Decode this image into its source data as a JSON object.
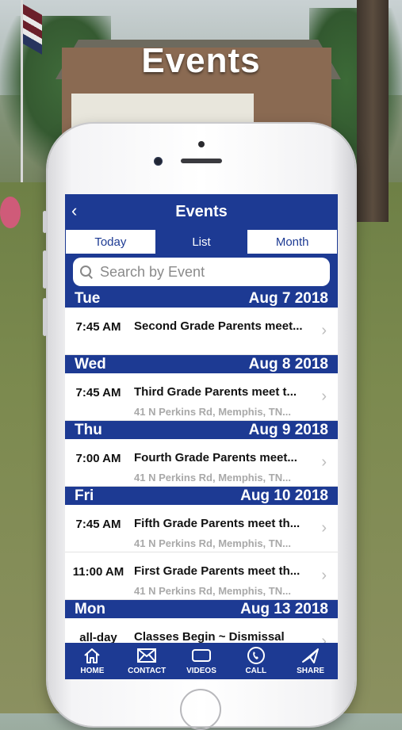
{
  "page": {
    "title": "Events"
  },
  "navbar": {
    "back_glyph": "‹",
    "title": "Events"
  },
  "segments": [
    {
      "label": "Today",
      "active": false
    },
    {
      "label": "List",
      "active": true
    },
    {
      "label": "Month",
      "active": false
    }
  ],
  "search": {
    "placeholder": "Search by Event"
  },
  "days": [
    {
      "weekday": "Tue",
      "date": "Aug 7 2018",
      "events": [
        {
          "time": "7:45 AM",
          "title": "Second Grade Parents meet...",
          "location": ""
        }
      ]
    },
    {
      "weekday": "Wed",
      "date": "Aug 8 2018",
      "events": [
        {
          "time": "7:45 AM",
          "title": "Third Grade Parents meet t...",
          "location": "41 N Perkins Rd, Memphis, TN..."
        }
      ]
    },
    {
      "weekday": "Thu",
      "date": "Aug 9 2018",
      "events": [
        {
          "time": "7:00 AM",
          "title": "Fourth Grade Parents meet...",
          "location": "41 N Perkins Rd, Memphis, TN..."
        }
      ]
    },
    {
      "weekday": "Fri",
      "date": "Aug 10 2018",
      "events": [
        {
          "time": "7:45 AM",
          "title": "Fifth Grade Parents meet th...",
          "location": "41 N Perkins Rd, Memphis, TN..."
        },
        {
          "time": "11:00 AM",
          "title": "First Grade Parents meet th...",
          "location": "41 N Perkins Rd, Memphis, TN..."
        }
      ]
    },
    {
      "weekday": "Mon",
      "date": "Aug 13 2018",
      "events": [
        {
          "time": "all-day",
          "title": "Classes Begin ~ Dismissal",
          "location": ""
        }
      ]
    }
  ],
  "tabbar": [
    {
      "label": "HOME",
      "icon": "home-icon"
    },
    {
      "label": "CONTACT",
      "icon": "envelope-icon"
    },
    {
      "label": "VIDEOS",
      "icon": "tv-icon"
    },
    {
      "label": "CALL",
      "icon": "phone-icon"
    },
    {
      "label": "SHARE",
      "icon": "share-icon"
    }
  ],
  "colors": {
    "brand": "#1d3a93",
    "location_text": "#a9a9a9"
  }
}
